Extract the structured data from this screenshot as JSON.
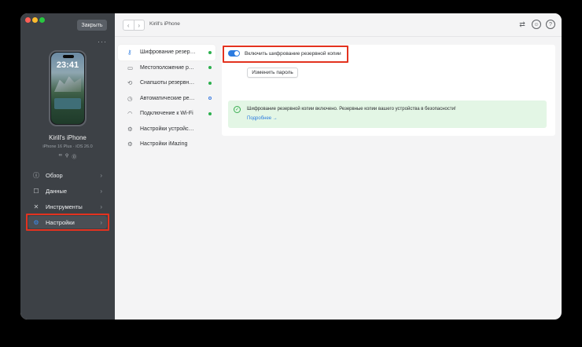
{
  "sidebar": {
    "close_label": "Закрыть",
    "more": "···",
    "phone": {
      "time": "23:41",
      "date": ""
    },
    "device_name": "Kirill's iPhone",
    "device_model": "iPhone 16 Plus · iOS 26.0",
    "device_icons": [
      "∞",
      "⚲",
      "⓪"
    ],
    "nav": [
      {
        "label": "Обзор",
        "icon": "info-icon",
        "glyph": "ⓘ"
      },
      {
        "label": "Данные",
        "icon": "data-icon",
        "glyph": "☐"
      },
      {
        "label": "Инструменты",
        "icon": "tools-icon",
        "glyph": "✕"
      },
      {
        "label": "Настройки",
        "icon": "gear-icon",
        "glyph": "⚙"
      }
    ],
    "chevron": "›"
  },
  "topbar": {
    "title": "Kirill's iPhone",
    "back": "‹",
    "forward": "›"
  },
  "settings_menu": [
    {
      "label": "Шифрование резер…",
      "icon": "key-icon",
      "glyph": "⚷"
    },
    {
      "label": "Местоположение р…",
      "icon": "folder-icon",
      "glyph": "▭"
    },
    {
      "label": "Снапшоты резервн…",
      "icon": "history-icon",
      "glyph": "⟲"
    },
    {
      "label": "Автоматические ре…",
      "icon": "clock-icon",
      "glyph": "◷"
    },
    {
      "label": "Подключение к Wi-Fi",
      "icon": "wifi-icon",
      "glyph": "◠"
    },
    {
      "label": "Настройки устройс…",
      "icon": "settings-icon",
      "glyph": "⚙"
    },
    {
      "label": "Настройки iMazing",
      "icon": "settings-icon",
      "glyph": "⚙"
    }
  ],
  "content": {
    "toggle_label": "Включить шифрование резервной копии",
    "toggle_on": true,
    "change_password": "Изменить пароль",
    "info_text": "Шифрование резервной копии включено. Резервные копии вашего устройства в безопасности!",
    "info_link": "Подробнее →"
  },
  "colors": {
    "accent": "#2b7be0",
    "highlight": "#e3321f",
    "success": "#3aae51",
    "sidebar": "#3d4146"
  }
}
